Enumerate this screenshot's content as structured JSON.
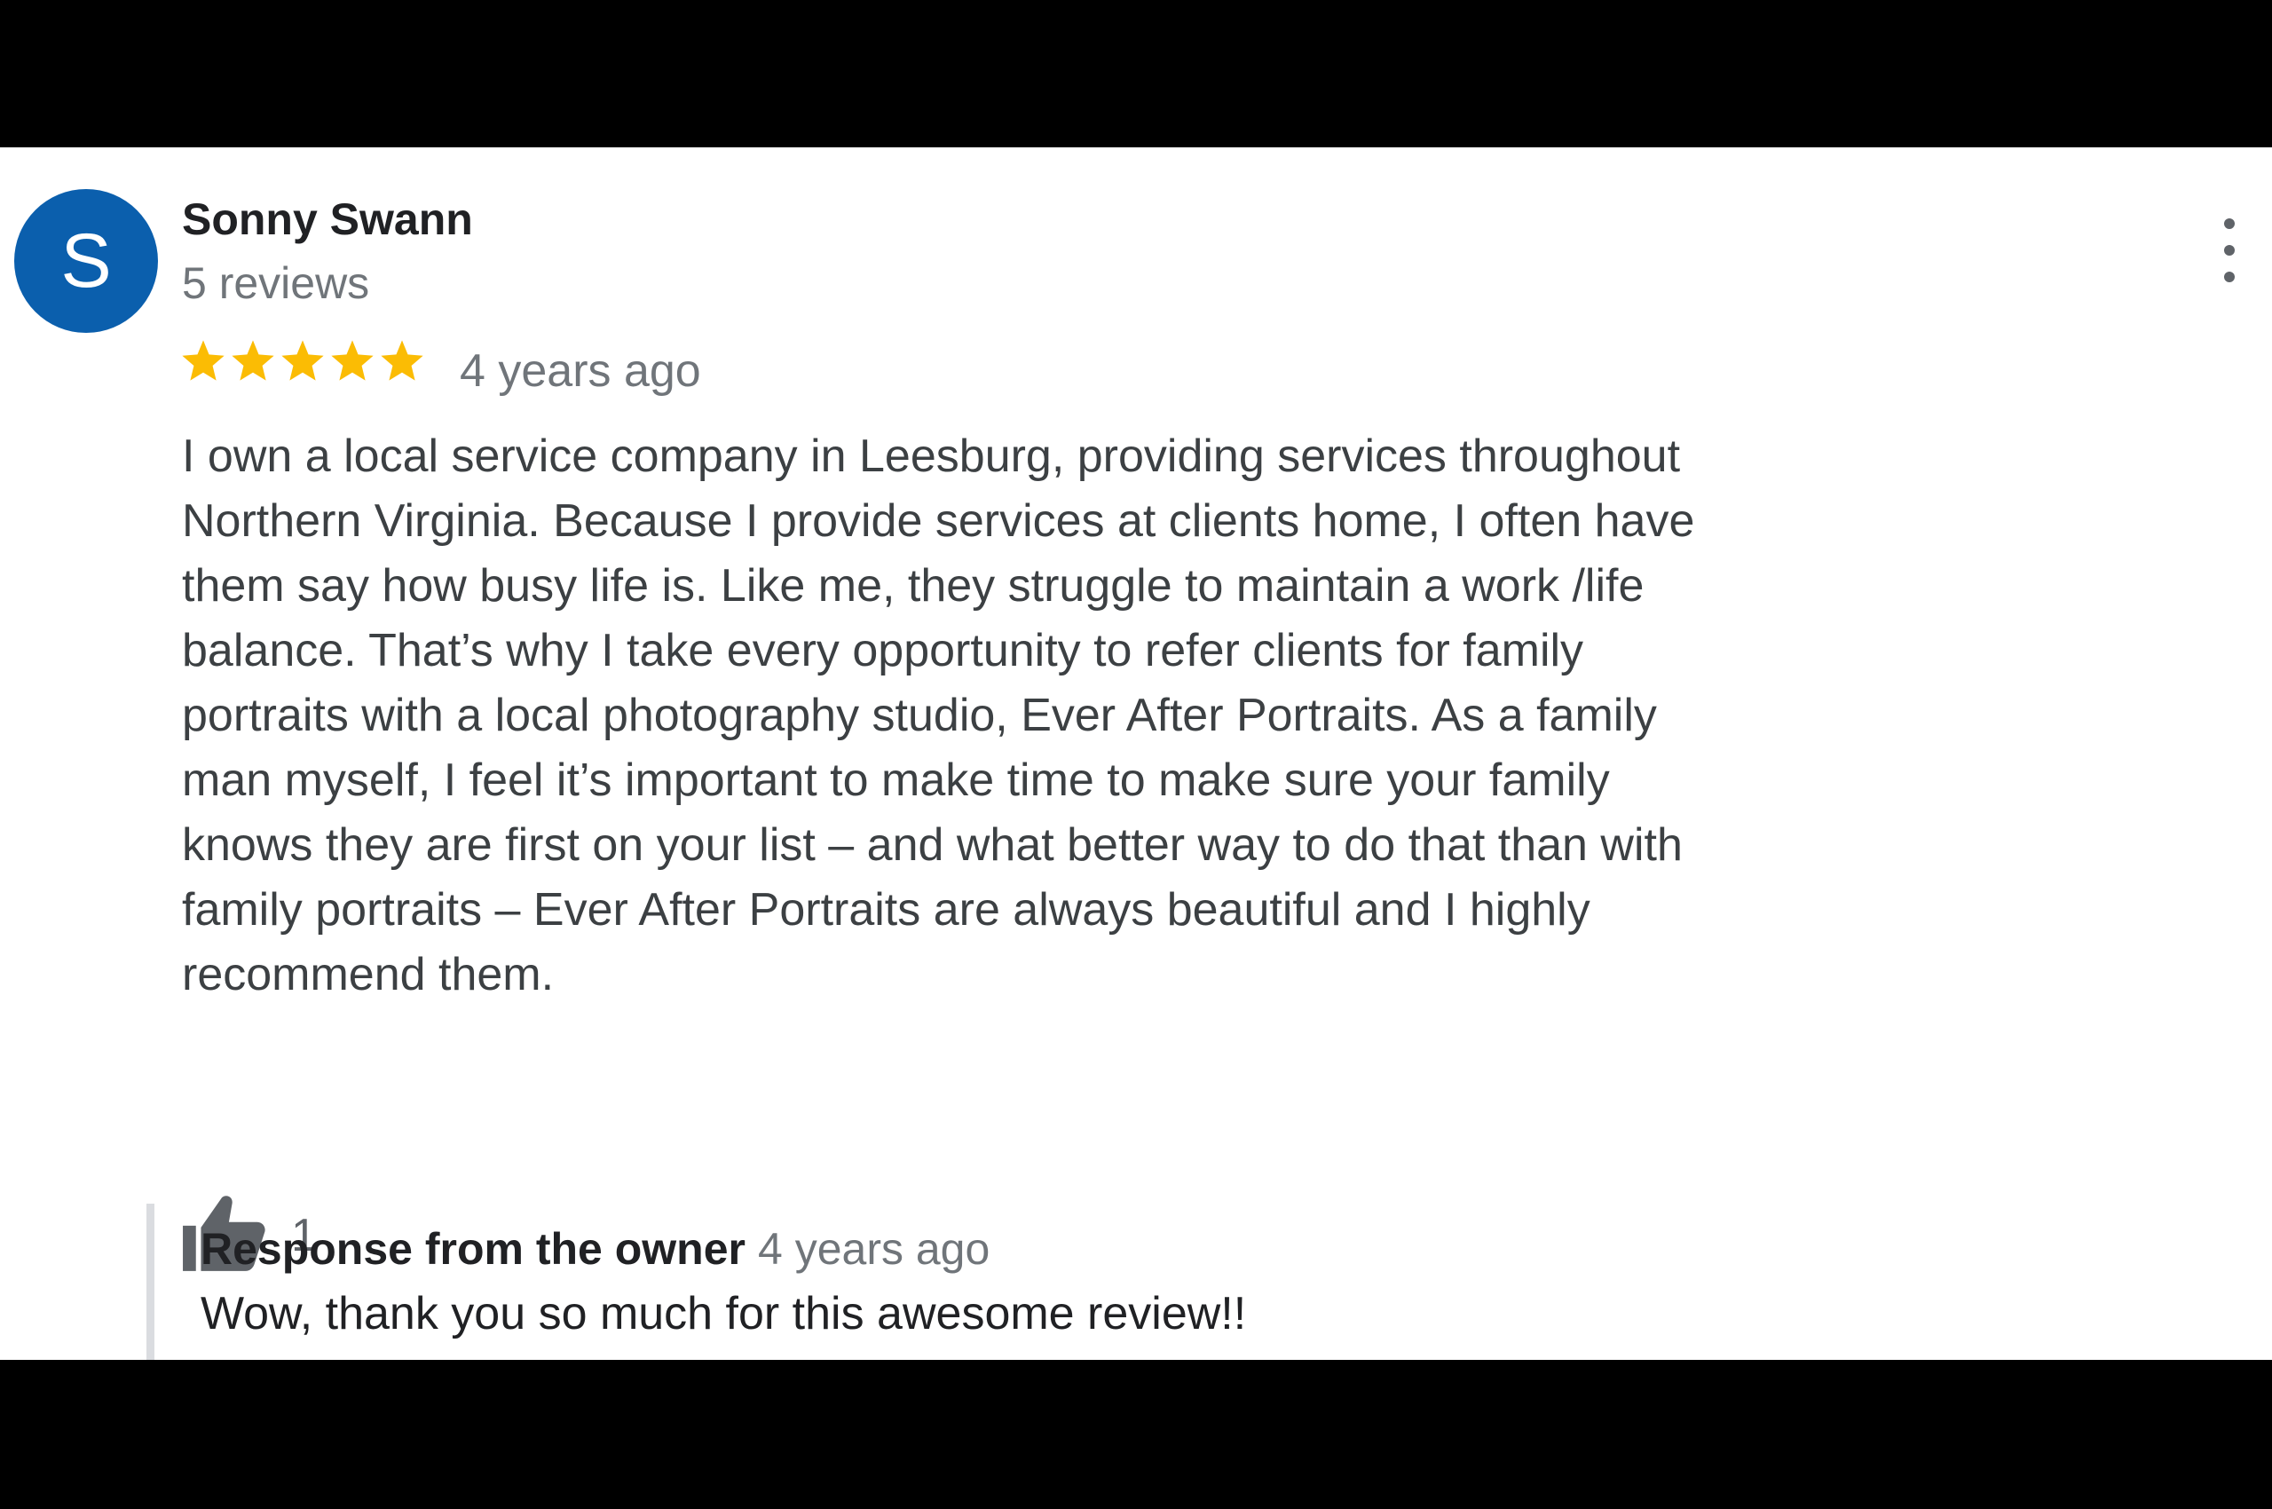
{
  "reviewer": {
    "avatar_initial": "S",
    "avatar_color": "#0b5fad",
    "name": "Sonny Swann",
    "review_count": "5 reviews"
  },
  "review": {
    "rating": 5,
    "rating_max": 5,
    "star_color": "#fbbc04",
    "time": "4 years ago",
    "text": "I own a local service company in Leesburg, providing services throughout Northern Virginia.  Because I provide services at clients home, I often have them say how busy life is.  Like me, they struggle to maintain a work /life balance.  That’s why I take every opportunity to refer clients for family portraits with a local photography studio, Ever After Portraits.  As a family man myself, I feel it’s important to make time to make sure your family knows they are first on your list – and what better way to do that than with family portraits – Ever After Portraits are always beautiful and I highly recommend them.",
    "like_icon": "thumbs-up-icon",
    "like_count": "1",
    "menu_icon": "more-vert-icon"
  },
  "response": {
    "title": "Response from the owner",
    "time": "4 years ago",
    "text": "Wow, thank you so much for this awesome review!!"
  }
}
